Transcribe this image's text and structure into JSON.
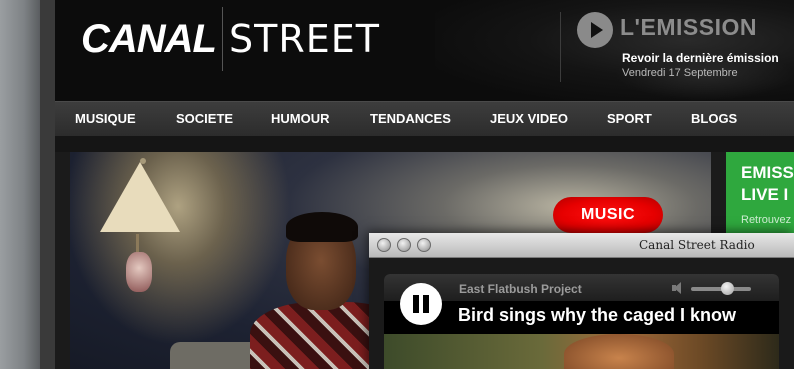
{
  "header": {
    "logo_canal": "CANAL",
    "logo_street": "STREET",
    "emission_title": "L'EMISSION",
    "emission_subtitle": "Revoir la dernière émission",
    "emission_date": "Vendredi 17 Septembre"
  },
  "nav": {
    "items": [
      {
        "label": "MUSIQUE"
      },
      {
        "label": "SOCIETE"
      },
      {
        "label": "HUMOUR"
      },
      {
        "label": "TENDANCES"
      },
      {
        "label": "JEUX VIDEO"
      },
      {
        "label": "SPORT"
      },
      {
        "label": "BLOGS"
      }
    ]
  },
  "hero": {
    "badge": "MUSIC"
  },
  "promo": {
    "title_line1": "EMISS",
    "title_line2": "LIVE I",
    "text": "Retrouvez"
  },
  "radio": {
    "window_title": "Canal Street Radio",
    "artist": "East Flatbush Project",
    "track": "Bird sings why the caged I know",
    "volume": 0.6
  },
  "colors": {
    "promo_green": "#2fa83e",
    "badge_red": "#e60000",
    "header_bg": "#0c0c0c",
    "nav_bg": "#333333"
  },
  "icons": {
    "play": "play-icon",
    "pause": "pause-icon",
    "speaker": "speaker-icon"
  }
}
